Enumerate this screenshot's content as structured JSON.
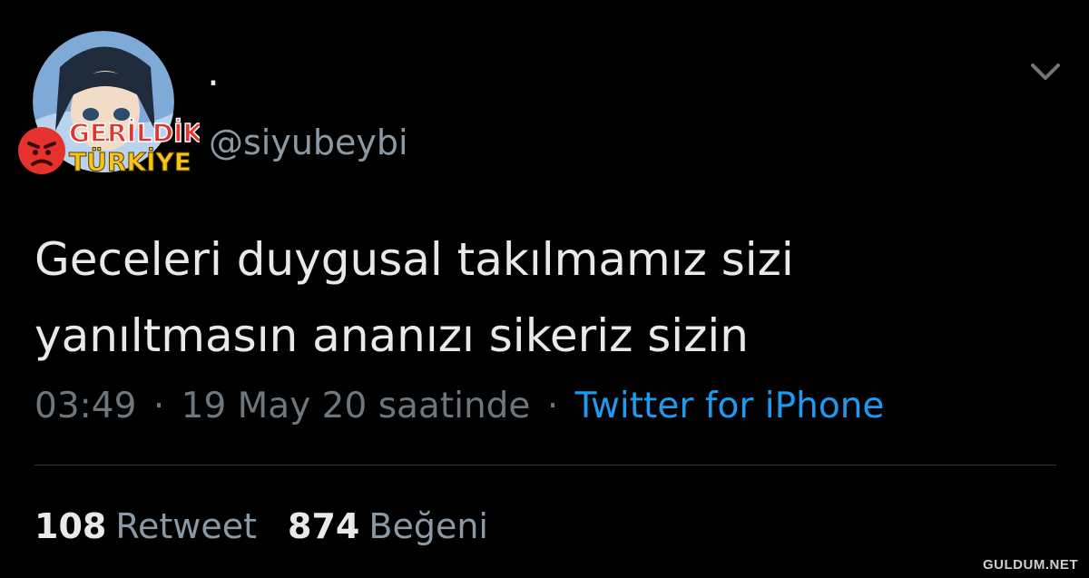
{
  "tweet": {
    "display_name": ".",
    "handle": "@siyubeybi",
    "text_lines": [
      "Geceleri duygusal takılmamız sizi",
      "yanıltmasın ananızı sikeriz sizin"
    ],
    "time": "03:49",
    "date": "19 May 20 saatinde",
    "separator": "·",
    "source": "Twitter for iPhone",
    "retweets": {
      "count": "108",
      "label": "Retweet"
    },
    "likes": {
      "count": "874",
      "label": "Beğeni"
    }
  },
  "icons": {
    "menu": "chevron-down-icon",
    "avatar": "avatar"
  },
  "watermarks": {
    "logo_line1": "GERİLDİK",
    "logo_line2": "TÜRKİYE",
    "site": "GULDUM.NET"
  },
  "colors": {
    "background": "#000000",
    "text_primary": "#e7e9ea",
    "text_secondary": "#8b98a5",
    "link": "#1d9bf0",
    "logo_red": "#e5322d",
    "logo_yellow": "#f5c518"
  }
}
